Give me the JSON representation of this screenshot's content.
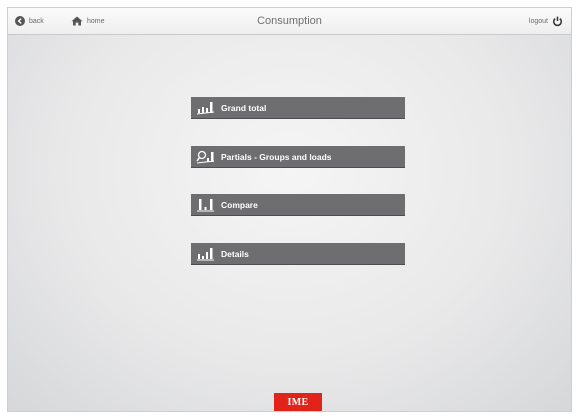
{
  "header": {
    "title": "Consumption",
    "back_label": "back",
    "home_label": "home",
    "logout_label": "logout"
  },
  "menu": {
    "items": [
      {
        "label": "Grand total",
        "icon": "bar-chart-icon"
      },
      {
        "label": "Partials - Groups and loads",
        "icon": "magnifier-chart-icon"
      },
      {
        "label": "Compare",
        "icon": "compare-bars-icon"
      },
      {
        "label": "Details",
        "icon": "detail-chart-icon"
      }
    ]
  },
  "footer": {
    "logo_text": "IME",
    "logo_color": "#e2231a"
  },
  "colors": {
    "button_bg": "#6e6e70",
    "button_text": "#ffffff",
    "header_text": "#707070"
  }
}
